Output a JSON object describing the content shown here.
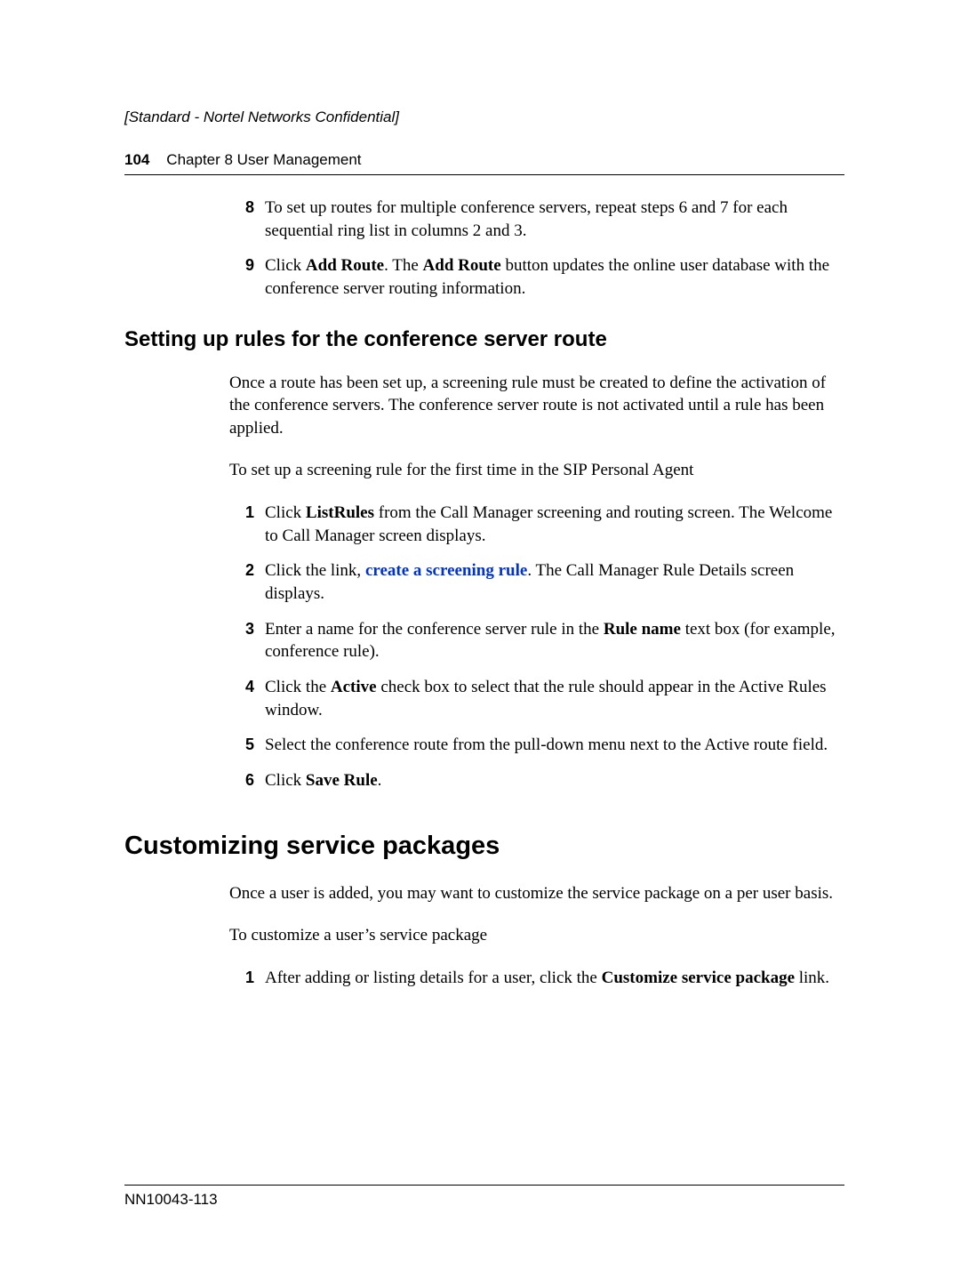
{
  "header": {
    "confidential": "[Standard - Nortel Networks Confidential]",
    "page_number": "104",
    "chapter": "Chapter 8  User Management"
  },
  "steps_top": {
    "s8": {
      "num": "8",
      "text_a": "To set up routes for multiple conference servers, repeat steps 6 and 7 for each sequential ring list in columns 2 and 3."
    },
    "s9": {
      "num": "9",
      "t1": "Click ",
      "b1": "Add Route",
      "t2": ". The ",
      "b2": "Add Route",
      "t3": " button updates the online user database with the conference server routing information."
    }
  },
  "subhead1": "Setting up rules for the conference server route",
  "para1": "Once a route has been set up, a screening rule must be created to define the activation of the conference servers. The conference server route is not activated until a rule has been applied.",
  "para2": "To set up a screening rule for the first time in the SIP Personal Agent",
  "steps_mid": {
    "s1": {
      "num": "1",
      "t1": "Click ",
      "b1": "ListRules",
      "t2": " from the Call Manager screening and routing screen. The Welcome to Call Manager screen displays."
    },
    "s2": {
      "num": "2",
      "t1": "Click the link, ",
      "link": "create a screening rule",
      "t2": ". The Call Manager Rule Details screen displays."
    },
    "s3": {
      "num": "3",
      "t1": "Enter a name for the conference server rule in the ",
      "b1": "Rule name",
      "t2": " text box (for example, conference rule)."
    },
    "s4": {
      "num": "4",
      "t1": "Click the ",
      "b1": "Active",
      "t2": " check box to select that the rule should appear in the Active Rules window."
    },
    "s5": {
      "num": "5",
      "t1": "Select the conference route from the pull-down menu next to the Active route field."
    },
    "s6": {
      "num": "6",
      "t1": "Click ",
      "b1": "Save Rule",
      "t2": "."
    }
  },
  "sectionhead": "Customizing service packages",
  "para3": "Once a user is added, you may want to customize the service package on a per user basis.",
  "para4": "To customize a user’s service package",
  "steps_bottom": {
    "s1": {
      "num": "1",
      "t1": "After adding or listing details for a user, click the ",
      "b1": "Customize service package",
      "t2": " link."
    }
  },
  "footer": {
    "docnum": "NN10043-113"
  }
}
